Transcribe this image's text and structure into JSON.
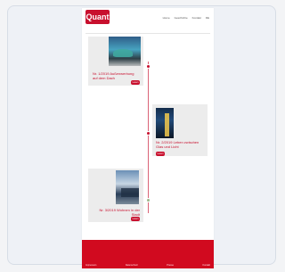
{
  "brand": {
    "logo_text": "Quant",
    "tagline": "",
    "color": "#c8102e"
  },
  "nav": {
    "items": [
      "Home",
      "Geschichte",
      "Kontakt",
      "DE"
    ]
  },
  "timeline": {
    "entries": [
      {
        "date": "",
        "title": "Nr. 1/2019 Außenwerbung auf dem Dach",
        "button": "Lesen"
      },
      {
        "date": "",
        "title": "Nr. 2/2019 Leben zwischen Glas und Licht",
        "button": "Lesen"
      },
      {
        "date": "",
        "title": "Nr. 3/2019 Wohnen in der Stadt",
        "button": "Lesen"
      }
    ]
  },
  "footer": {
    "links": [
      "Impressum",
      "Datenschutz",
      "Presse",
      "Kontakt"
    ],
    "color": "#d10a1f"
  },
  "icons": [
    "timeline-dot-icon",
    "timeline-dot-icon",
    "timeline-dot-icon"
  ]
}
